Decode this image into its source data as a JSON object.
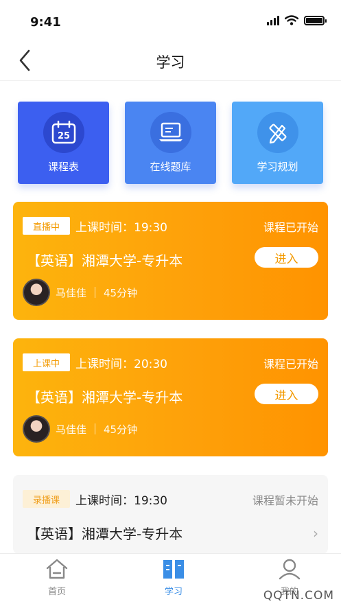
{
  "status_bar": {
    "time": "9:41"
  },
  "header": {
    "title": "学习"
  },
  "tiles": [
    {
      "label": "课程表",
      "icon": "calendar-icon",
      "color": "#3c5ff0"
    },
    {
      "label": "在线题库",
      "icon": "laptop-icon",
      "color": "#4a85f2"
    },
    {
      "label": "学习规划",
      "icon": "pencil-ruler-icon",
      "color": "#52a8f8"
    }
  ],
  "cards": [
    {
      "badge": "直播中",
      "time": "上课时间：19:30",
      "status": "课程已开始",
      "title": "【英语】湘潭大学-专升本",
      "enter": "进入",
      "teacher": "马佳佳",
      "duration": "45分钟"
    },
    {
      "badge": "上课中",
      "time": "上课时间：20:30",
      "status": "课程已开始",
      "title": "【英语】湘潭大学-专升本",
      "enter": "进入",
      "teacher": "马佳佳",
      "duration": "45分钟"
    },
    {
      "badge": "录播课",
      "time": "上课时间：19:30",
      "status": "课程暂未开始",
      "title": "【英语】湘潭大学-专升本",
      "chevron": "›"
    }
  ],
  "tabbar": {
    "items": [
      {
        "label": "首页",
        "icon": "home-icon",
        "active": false
      },
      {
        "label": "学习",
        "icon": "book-icon",
        "active": true
      },
      {
        "label": "我的",
        "icon": "user-icon",
        "active": false
      }
    ],
    "active_color": "#3a8ee6",
    "inactive_color": "#888888"
  },
  "watermark": "QQTN.COM"
}
